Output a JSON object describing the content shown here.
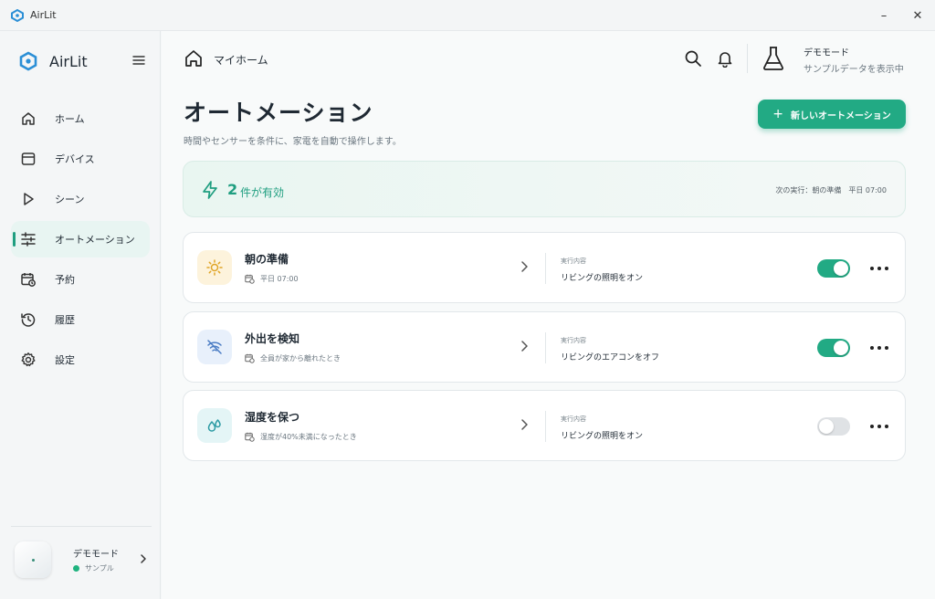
{
  "window": {
    "title": "AirLit",
    "minimize": "–",
    "close": "✕"
  },
  "sidebar": {
    "brand": "AirLit",
    "items": [
      {
        "label": "ホーム",
        "icon": "home-icon",
        "active": false
      },
      {
        "label": "デバイス",
        "icon": "device-icon",
        "active": false
      },
      {
        "label": "シーン",
        "icon": "play-icon",
        "active": false
      },
      {
        "label": "オートメーション",
        "icon": "sliders-icon",
        "active": true
      },
      {
        "label": "予約",
        "icon": "calendar-clock-icon",
        "active": false
      },
      {
        "label": "履歴",
        "icon": "history-icon",
        "active": false
      },
      {
        "label": "設定",
        "icon": "gear-icon",
        "active": false
      }
    ],
    "profile": {
      "name": "デモモード",
      "status": "サンプル"
    }
  },
  "topbar": {
    "breadcrumb": "マイホーム",
    "demo_title": "デモモード",
    "demo_subtitle": "サンプルデータを表示中"
  },
  "page": {
    "title": "オートメーション",
    "subtitle": "時間やセンサーを条件に、家電を自動で操作します。",
    "new_button": "新しいオートメーション"
  },
  "summary": {
    "count": "2",
    "count_label": "件が有効",
    "next_run": "次の実行：朝の準備　平日 07:00"
  },
  "automations": [
    {
      "name": "朝の準備",
      "trigger": "平日 07:00",
      "action_label": "実行内容",
      "action": "リビングの照明をオン",
      "enabled": true,
      "icon": "sun-icon",
      "badge_color": "#fdf3dc",
      "icon_color": "#e0a526"
    },
    {
      "name": "外出を検知",
      "trigger": "全員が家から離れたとき",
      "action_label": "実行内容",
      "action": "リビングのエアコンをオフ",
      "enabled": true,
      "icon": "wifi-off-icon",
      "badge_color": "#e8f0fb",
      "icon_color": "#4a7cc4"
    },
    {
      "name": "湿度を保つ",
      "trigger": "湿度が40%未満になったとき",
      "action_label": "実行内容",
      "action": "リビングの照明をオン",
      "enabled": false,
      "icon": "droplets-icon",
      "badge_color": "#e4f5f6",
      "icon_color": "#2a9aa3"
    }
  ],
  "colors": {
    "accent": "#22aa84",
    "accent_dark": "#1f9e80",
    "toggle_off": "#dfe2e5"
  }
}
